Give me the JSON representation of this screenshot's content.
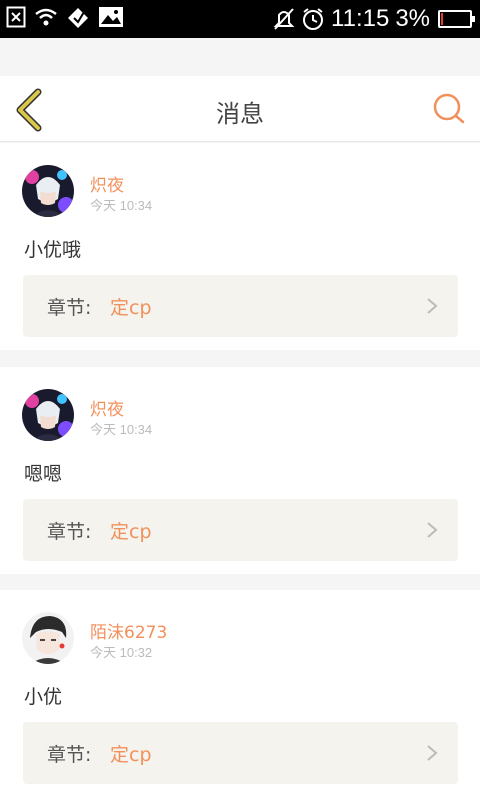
{
  "status_bar": {
    "time": "11:15",
    "battery": "3%",
    "icons": [
      "close-box-icon",
      "wifi-icon",
      "signal-icon",
      "image-icon",
      "mute-icon",
      "alarm-icon",
      "battery-icon"
    ]
  },
  "header": {
    "title": "消息",
    "back_icon": "chevron-left-icon",
    "search_icon": "search-icon"
  },
  "colors": {
    "accent": "#f2905c",
    "back_icon": "#d9c84a",
    "chapter_bg": "#f4f3ee"
  },
  "messages": [
    {
      "user": "炽夜",
      "time": "今天 10:34",
      "content": "小优哦",
      "chapter_label": "章节:",
      "chapter_name": "定cp"
    },
    {
      "user": "炽夜",
      "time": "今天 10:34",
      "content": "嗯嗯",
      "chapter_label": "章节:",
      "chapter_name": "定cp"
    },
    {
      "user": "陌沫6273",
      "time": "今天 10:32",
      "content": "小优",
      "chapter_label": "章节:",
      "chapter_name": "定cp"
    }
  ]
}
